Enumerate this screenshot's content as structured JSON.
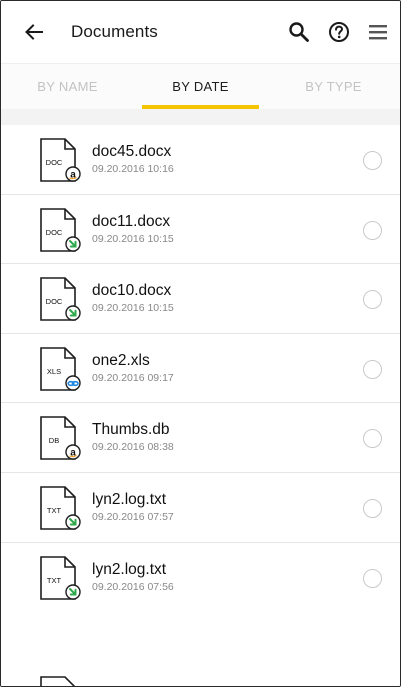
{
  "header": {
    "back_icon": "arrow-left-icon",
    "title": "Documents",
    "actions": [
      "search-icon",
      "help-icon",
      "menu-icon"
    ]
  },
  "tabs": [
    {
      "label": "BY NAME",
      "active": false
    },
    {
      "label": "BY DATE",
      "active": true
    },
    {
      "label": "BY TYPE",
      "active": false
    }
  ],
  "colors": {
    "accent": "#f5c400",
    "amazon_badge": "#f2a12b",
    "green_badge": "#2ea84a",
    "blue_badge": "#1e88e5"
  },
  "files": [
    {
      "name": "doc45.docx",
      "date": "09.20.2016 10:16",
      "type": "DOC",
      "badge": "amazon-icon"
    },
    {
      "name": "doc11.docx",
      "date": "09.20.2016 10:15",
      "type": "DOC",
      "badge": "green-arrow-icon"
    },
    {
      "name": "doc10.docx",
      "date": "09.20.2016 10:15",
      "type": "DOC",
      "badge": "green-arrow-icon"
    },
    {
      "name": "one2.xls",
      "date": "09.20.2016 09:17",
      "type": "XLS",
      "badge": "blue-link-icon"
    },
    {
      "name": "Thumbs.db",
      "date": "09.20.2016 08:38",
      "type": "DB",
      "badge": "amazon-icon"
    },
    {
      "name": "lyn2.log.txt",
      "date": "09.20.2016 07:57",
      "type": "TXT",
      "badge": "green-arrow-icon"
    },
    {
      "name": "lyn2.log.txt",
      "date": "09.20.2016 07:56",
      "type": "TXT",
      "badge": "green-arrow-icon"
    }
  ]
}
